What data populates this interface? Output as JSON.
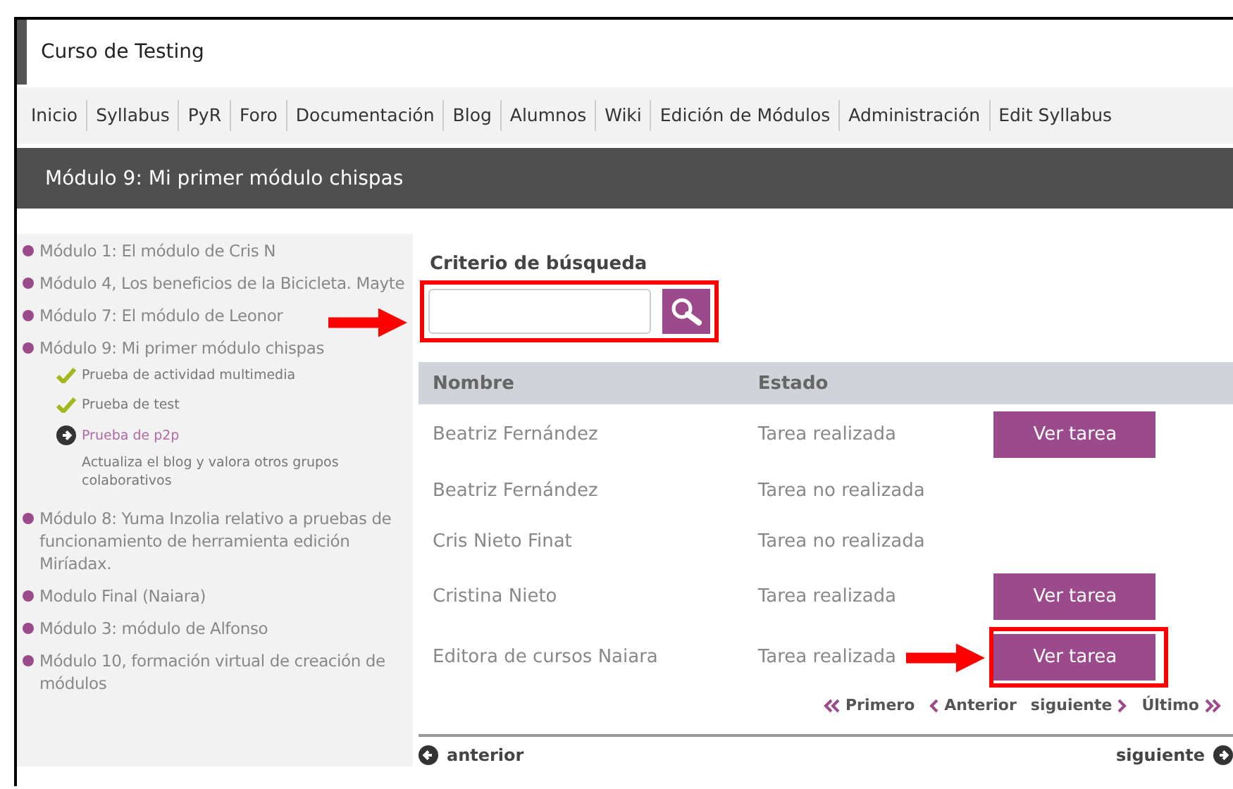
{
  "course_title": "Curso de Testing",
  "nav": [
    "Inicio",
    "Syllabus",
    "PyR",
    "Foro",
    "Documentación",
    "Blog",
    "Alumnos",
    "Wiki",
    "Edición de Módulos",
    "Administración",
    "Edit Syllabus"
  ],
  "module_header": "Módulo 9: Mi primer módulo chispas",
  "sidebar": {
    "items": [
      {
        "label": "Módulo 1: El módulo de Cris N"
      },
      {
        "label": "Módulo 4, Los beneficios de la Bicicleta. Mayte"
      },
      {
        "label": "Módulo 7: El módulo de Leonor"
      },
      {
        "label": "Módulo 9: Mi primer módulo chispas",
        "children": [
          {
            "kind": "done",
            "label": "Prueba de actividad multimedia"
          },
          {
            "kind": "done",
            "label": "Prueba de test"
          },
          {
            "kind": "current",
            "label": "Prueba de p2p"
          },
          {
            "kind": "note",
            "label": "Actualiza el blog y valora otros grupos colaborativos"
          }
        ]
      },
      {
        "label": "Módulo 8: Yuma Inzolia relativo a pruebas de funcionamiento de herramienta edición Miríadax."
      },
      {
        "label": "Modulo Final (Naiara)"
      },
      {
        "label": "Módulo 3: módulo de Alfonso"
      },
      {
        "label": "Módulo 10, formación virtual de creación de módulos"
      }
    ]
  },
  "search": {
    "label": "Criterio de búsqueda",
    "highlighted": true
  },
  "table": {
    "columns": [
      "Nombre",
      "Estado"
    ],
    "rows": [
      {
        "name": "Beatriz Fernández",
        "status": "Tarea realizada",
        "action": "Ver tarea",
        "highlighted": false
      },
      {
        "name": "Beatriz Fernández",
        "status": "Tarea no realizada"
      },
      {
        "name": "Cris Nieto Finat",
        "status": "Tarea no realizada"
      },
      {
        "name": "Cristina Nieto",
        "status": "Tarea realizada",
        "action": "Ver tarea",
        "highlighted": false
      },
      {
        "name": "Editora de cursos Naiara",
        "status": "Tarea realizada",
        "action": "Ver tarea",
        "highlighted": true
      }
    ]
  },
  "pagination": {
    "first": "Primero",
    "prev": "Anterior",
    "next": "siguiente",
    "last": "Último"
  },
  "footer_nav": {
    "prev": "anterior",
    "next": "siguiente"
  }
}
